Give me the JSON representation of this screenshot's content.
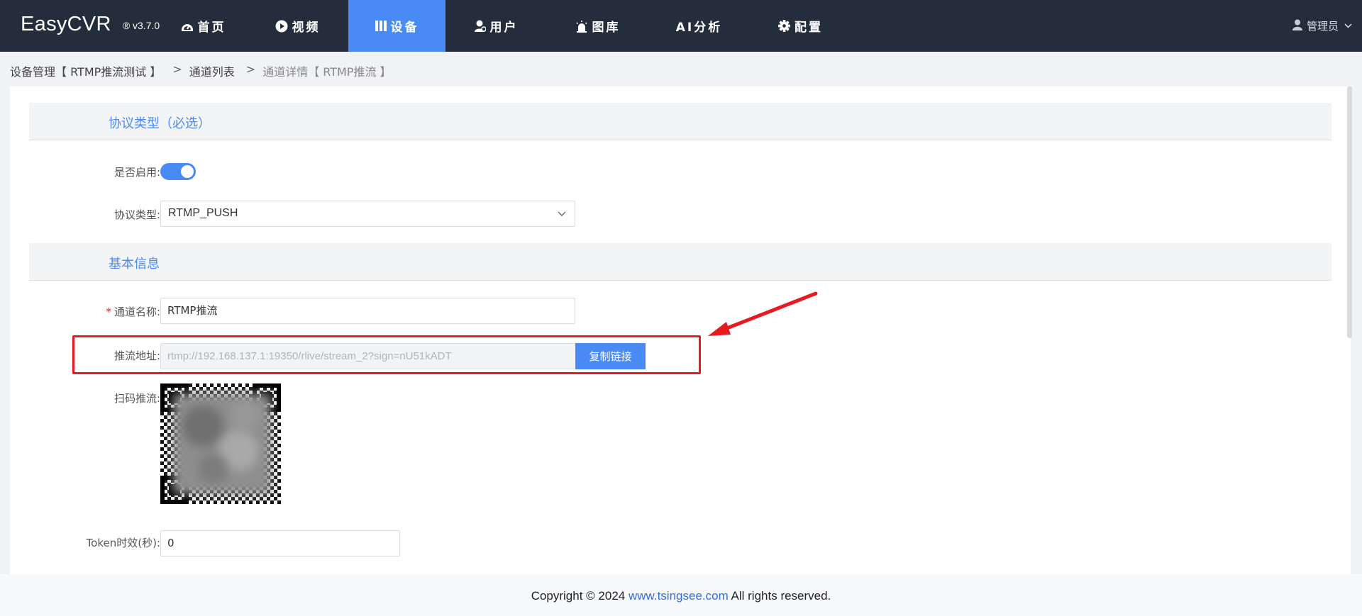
{
  "app": {
    "name": "EasyCVR",
    "version": "® v3.7.0"
  },
  "nav": {
    "items": [
      {
        "label": "首页",
        "icon": "dashboard-icon"
      },
      {
        "label": "视频",
        "icon": "play-icon"
      },
      {
        "label": "设备",
        "icon": "device-icon"
      },
      {
        "label": "用户",
        "icon": "user-icon"
      },
      {
        "label": "图库",
        "icon": "alarm-icon"
      },
      {
        "label": "AI分析",
        "icon": ""
      },
      {
        "label": "配置",
        "icon": "gear-icon"
      }
    ],
    "active_index": 2
  },
  "user": {
    "name": "管理员"
  },
  "breadcrumb": {
    "level1": "设备管理【 RTMP推流测试 】",
    "sep": ">",
    "level2": "通道列表",
    "level3": "通道详情【 RTMP推流 】"
  },
  "sections": {
    "protocol": "协议类型（必选）",
    "basic": "基本信息"
  },
  "form": {
    "enabled_label": "是否启用:",
    "enabled": true,
    "protocol_label": "协议类型:",
    "protocol_value": "RTMP_PUSH",
    "channel_name_label": "通道名称:",
    "channel_name_value": "RTMP推流",
    "push_url_label": "推流地址:",
    "push_url_value": "rtmp://192.168.137.1:19350/rlive/stream_2?sign=nU51kADT",
    "copy_label": "复制链接",
    "qr_label": "扫码推流:",
    "token_label": "Token时效(秒):",
    "token_value": "0"
  },
  "footer": {
    "prefix": "Copyright © 2024 ",
    "link": "www.tsingsee.com",
    "suffix": " All rights reserved."
  },
  "colors": {
    "topbar": "#232d3b",
    "accent": "#4a8af4",
    "highlight": "#e8191f"
  }
}
